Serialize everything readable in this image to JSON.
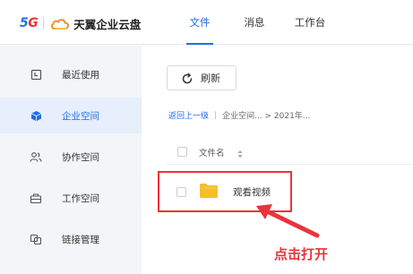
{
  "header": {
    "logo_5g": "5",
    "logo_5g_g": "G",
    "app_name": "天翼企业云盘",
    "nav": [
      {
        "label": "文件",
        "active": true
      },
      {
        "label": "消息",
        "active": false
      },
      {
        "label": "工作台",
        "active": false
      }
    ]
  },
  "sidebar": {
    "items": [
      {
        "label": "最近使用",
        "icon": "recent-icon"
      },
      {
        "label": "企业空间",
        "icon": "cube-icon",
        "active": true
      },
      {
        "label": "协作空间",
        "icon": "users-icon"
      },
      {
        "label": "工作空间",
        "icon": "briefcase-icon"
      },
      {
        "label": "链接管理",
        "icon": "link-icon"
      }
    ]
  },
  "toolbar": {
    "refresh_label": "刷新"
  },
  "breadcrumb": {
    "back": "返回上一级",
    "sep": "|",
    "path": "企业空间... > 2021年..."
  },
  "table": {
    "header_name": "文件名",
    "rows": [
      {
        "name": "观看视频",
        "type": "folder"
      }
    ]
  },
  "annotation": {
    "text": "点击打开"
  },
  "colors": {
    "accent": "#1f6ee8",
    "annotation_red": "#e8343b",
    "folder_yellow": "#f5bf2b",
    "sidebar_bg": "#f4f5f8"
  }
}
